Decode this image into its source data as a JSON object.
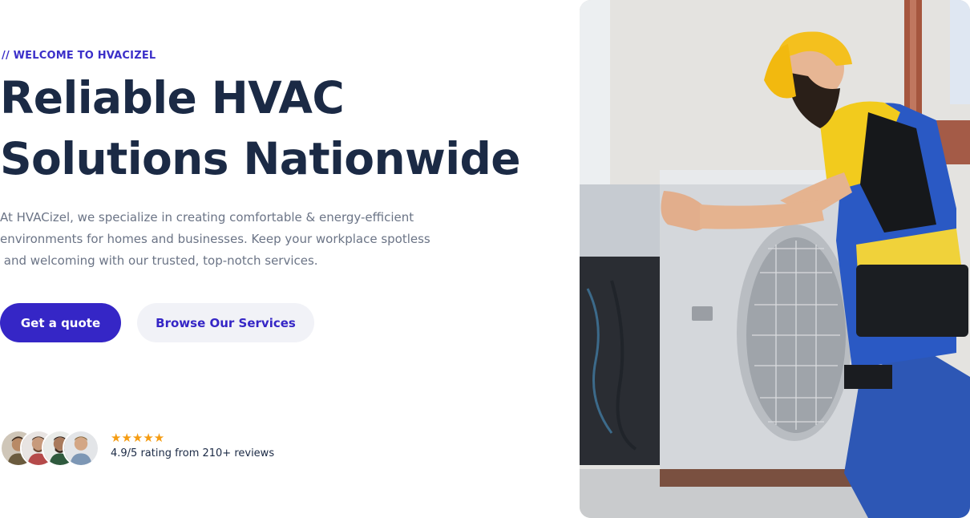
{
  "hero": {
    "eyebrow": "// WELCOME TO HVACIZEL",
    "headline_line1": "Reliable HVAC",
    "headline_line2": "Solutions Nationwide",
    "description_line1": "At HVACizel, we specialize in creating comfortable & energy-efficient",
    "description_line2": "environments for homes and businesses. Keep your workplace spotless",
    "description_line3": " and welcoming with our trusted, top-notch services."
  },
  "buttons": {
    "primary_label": "Get a quote",
    "secondary_label": "Browse Our Services"
  },
  "reviews": {
    "stars": "★★★★★",
    "rating_value": 4.9,
    "rating_text": "4.9/5 rating from 210+ reviews"
  },
  "colors": {
    "accent": "#3526c6",
    "heading": "#1b2a45",
    "body_text": "#6b7486",
    "star": "#f59c12",
    "secondary_button_bg": "#f1f2f7"
  },
  "icons": {
    "star": "star-icon",
    "avatars": [
      "avatar-1",
      "avatar-2",
      "avatar-3",
      "avatar-4"
    ]
  }
}
